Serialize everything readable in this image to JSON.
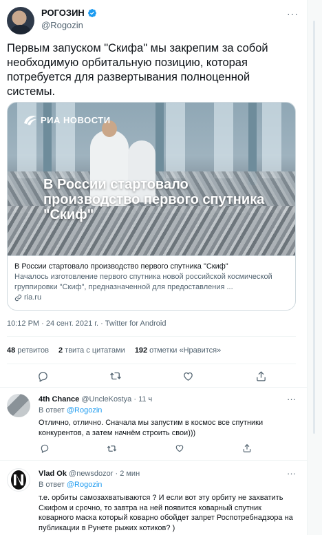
{
  "tweet": {
    "author_name": "РОГОЗИН",
    "author_handle": "@Rogozin",
    "more_label": "···",
    "text": "Первым запуском \"Скифа\" мы закрепим за собой необходимую орбитальную позицию, которая потребуется для развертывания полноценной системы.",
    "timestamp": "10:12 PM · 24 сент. 2021 г. · Twitter for Android"
  },
  "card": {
    "source_logo_text": "РИА НОВОСТИ",
    "image_headline": "В России стартовало производство первого спутника \"Скиф\"",
    "title": "В России стартовало производство первого спутника \"Скиф\"",
    "description": "Началось изготовление первого спутника новой российской космической группировки \"Скиф\", предназначенной для предоставления ...",
    "domain": "ria.ru"
  },
  "stats": {
    "retweets_count": "48",
    "retweets_label": "ретвитов",
    "quotes_count": "2",
    "quotes_label": "твита с цитатами",
    "likes_count": "192",
    "likes_label": "отметки «Нравится»"
  },
  "actions": {
    "icons": [
      "reply-icon",
      "retweet-icon",
      "like-icon",
      "share-icon"
    ]
  },
  "replies": [
    {
      "name": "4th Chance",
      "handle": "@UncleKostya",
      "time": "· 11 ч",
      "reply_to_label": "В ответ",
      "reply_to_handle": "@Rogozin",
      "text": "Отлично, отлично. Сначала мы запустим в космос все спутники конкурентов, а затем начнём строить свои)))"
    },
    {
      "name": "Vlad Ok",
      "handle": "@newsdozor",
      "time": "· 2 мин",
      "reply_to_label": "В ответ",
      "reply_to_handle": "@Rogozin",
      "text": "т.е. орбиты самозахватываются ? И если вот эту орбиту не захватить Скифом и срочно, то завтра на ней появится коварный спутник коварного маска который коварно обойдет запрет Роспотребнадзора на публикации в Рунете рыжих котиков? )"
    }
  ],
  "colors": {
    "accent": "#1d9bf0",
    "text": "#0f1419",
    "muted": "#536471",
    "border": "#cfd9de"
  }
}
